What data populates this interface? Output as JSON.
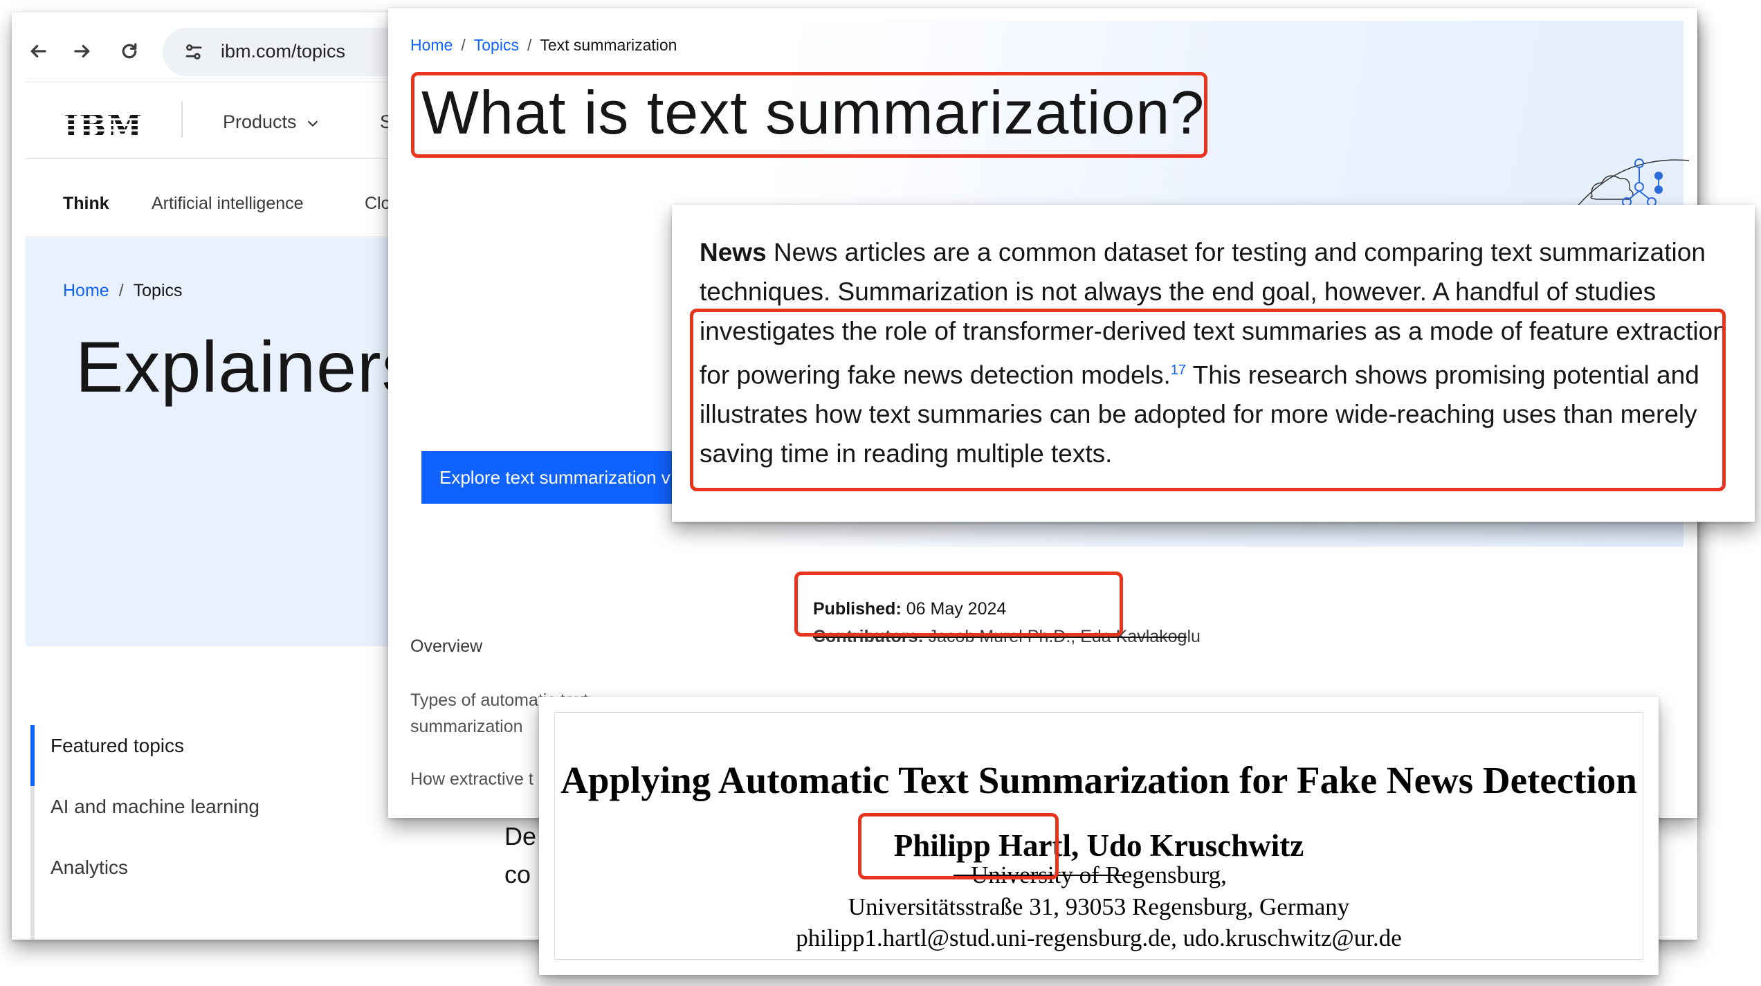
{
  "ibm_window": {
    "url": "ibm.com/topics",
    "logo": "IBM",
    "nav_products": "Products",
    "nav_partial": "Sc",
    "subnav": {
      "think": "Think",
      "ai": "Artificial intelligence",
      "partial": "Clou"
    },
    "breadcrumb": {
      "home": "Home",
      "sep": "/",
      "topics": "Topics"
    },
    "hero_title": "Explainers",
    "side_nav": [
      {
        "label": "Featured topics"
      },
      {
        "label": "AI and machine learning"
      },
      {
        "label": "Analytics"
      }
    ],
    "body_fragment_1": "De",
    "body_fragment_2": "co"
  },
  "article_window": {
    "breadcrumb": {
      "home": "Home",
      "topics": "Topics",
      "current": "Text summarization",
      "sep": "/"
    },
    "title": "What is text summarization?",
    "cta_label": "Explore text summarization v",
    "toc": {
      "overview": "Overview",
      "types_line1": "Types of automatic text",
      "types_line2": "summarization",
      "how_extractive": "How extractive t"
    },
    "published_label": "Published:",
    "published_date": "06 May 2024",
    "contributors_label": "Contributors:",
    "contributors": "Jacob Murel Ph.D., Eda Kavlakoglu"
  },
  "news_snippet": {
    "heading": "News",
    "text_before": " News articles are a common dataset for testing and comparing text summarization techniques. Summarization is not always the end goal, however. A handful of studies investigates the role of transformer-derived text summaries as a mode of feature extraction for powering fake news detection models.",
    "citation": "17",
    "text_after": " This research shows promising potential and illustrates how text summaries can be adopted for more wide-reaching uses than merely saving time in reading multiple texts."
  },
  "paper": {
    "title": "Applying Automatic Text Summarization for Fake News Detection",
    "authors": "Philipp Hartl, Udo Kruschwitz",
    "affiliation": "University of Regensburg,",
    "address": "Universitätsstraße 31, 93053 Regensburg, Germany",
    "emails": "philipp1.hartl@stud.uni-regensburg.de, udo.kruschwitz@ur.de"
  },
  "colors": {
    "highlight": "#e8341c",
    "ibm_blue": "#0f62fe",
    "hero_bg": "#e8f1fd"
  }
}
